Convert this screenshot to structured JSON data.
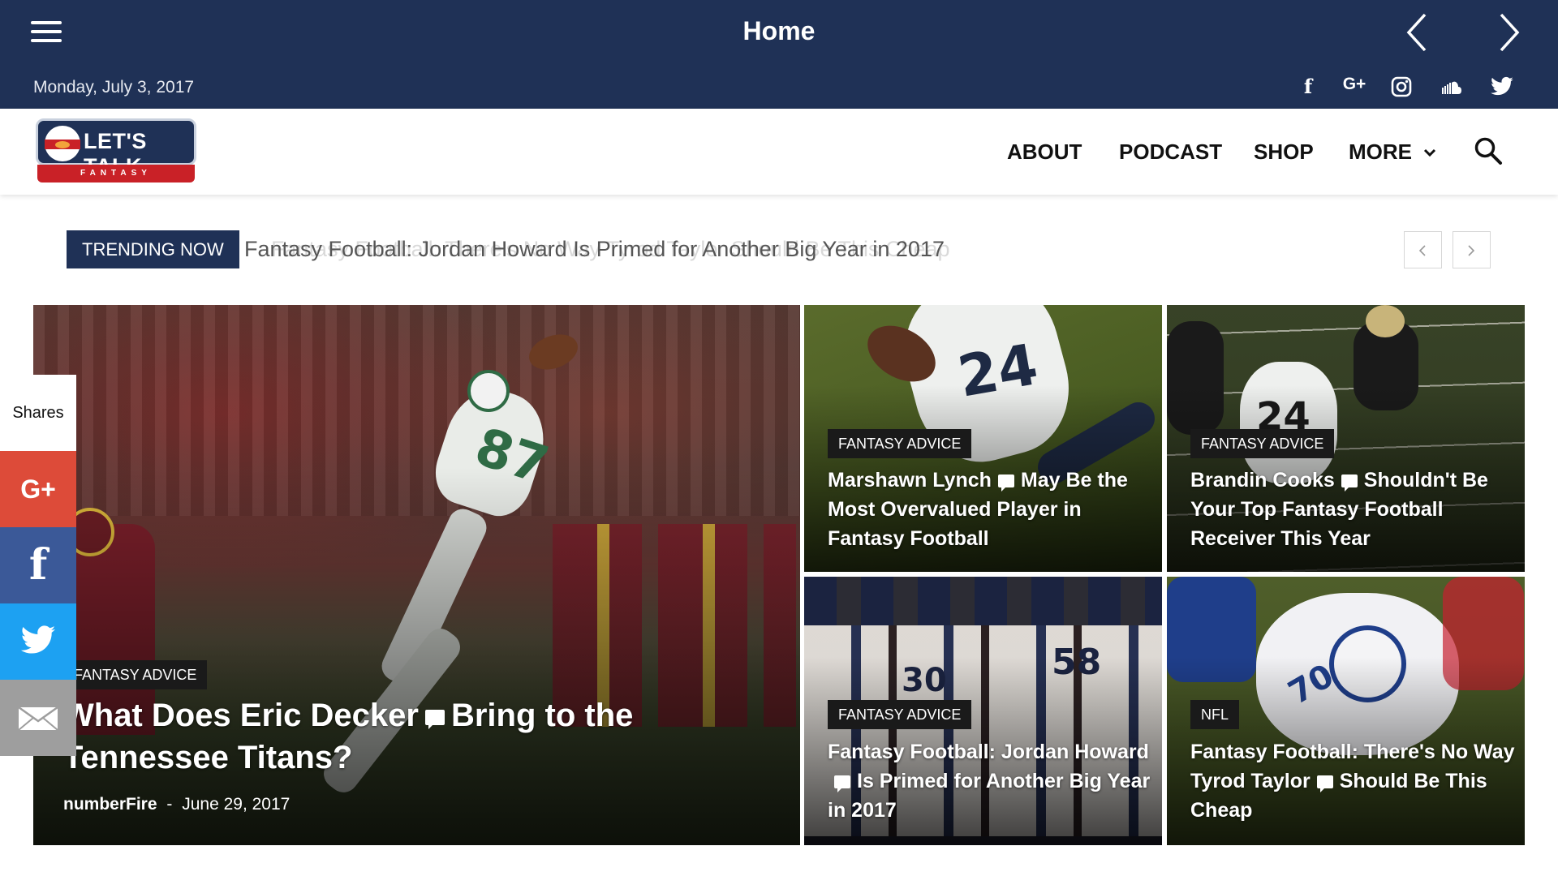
{
  "topbar": {
    "title": "Home",
    "date": "Monday, July 3, 2017",
    "social": [
      "facebook-icon",
      "google-plus-icon",
      "instagram-icon",
      "soundcloud-icon",
      "twitter-icon"
    ],
    "facebook_glyph": "f",
    "googleplus_glyph": "G+"
  },
  "logo": {
    "title": "LET'S TALK",
    "subtitle": "FANTASY FOOTBALL"
  },
  "menu": {
    "about": "ABOUT",
    "podcast": "PODCAST",
    "shop": "SHOP",
    "more": "MORE"
  },
  "trending": {
    "label": "TRENDING NOW",
    "text": "Fantasy Football: Jordan Howard Is Primed for Another Big Year in 2017",
    "ghost_text": "Fantasy Football: There's No Way Tyrod Taylor Should Be This Cheap"
  },
  "featured": {
    "category": "FANTASY ADVICE",
    "title_part1": "What Does Eric Decker",
    "title_part2": "Bring to the Tennessee Titans?",
    "author": "numberFire",
    "separator": "-",
    "date": "June 29, 2017"
  },
  "cards": [
    {
      "category": "FANTASY ADVICE",
      "title_part1": "Marshawn Lynch",
      "title_part2": "May Be the Most Overvalued Player in Fantasy Football"
    },
    {
      "category": "FANTASY ADVICE",
      "title_part1": "Brandin Cooks",
      "title_part2": "Shouldn't Be Your Top Fantasy Football Receiver This Year"
    },
    {
      "category": "FANTASY ADVICE",
      "title_part1": "Fantasy Football: Jordan Howard",
      "title_part2": "Is Primed for Another Big Year in 2017"
    },
    {
      "category": "NFL",
      "title_part1": "Fantasy Football: There's No Way Tyrod Taylor",
      "title_part2": "Should Be This Cheap"
    }
  ],
  "shares": {
    "label": "Shares",
    "googleplus_glyph": "G+",
    "facebook_glyph": "f",
    "colors": {
      "googleplus": "#dd4b39",
      "facebook": "#3b5998",
      "twitter": "#1da1f2",
      "email": "#9e9e9e"
    }
  },
  "colors": {
    "navy": "#1f3156",
    "red": "#c92127"
  }
}
